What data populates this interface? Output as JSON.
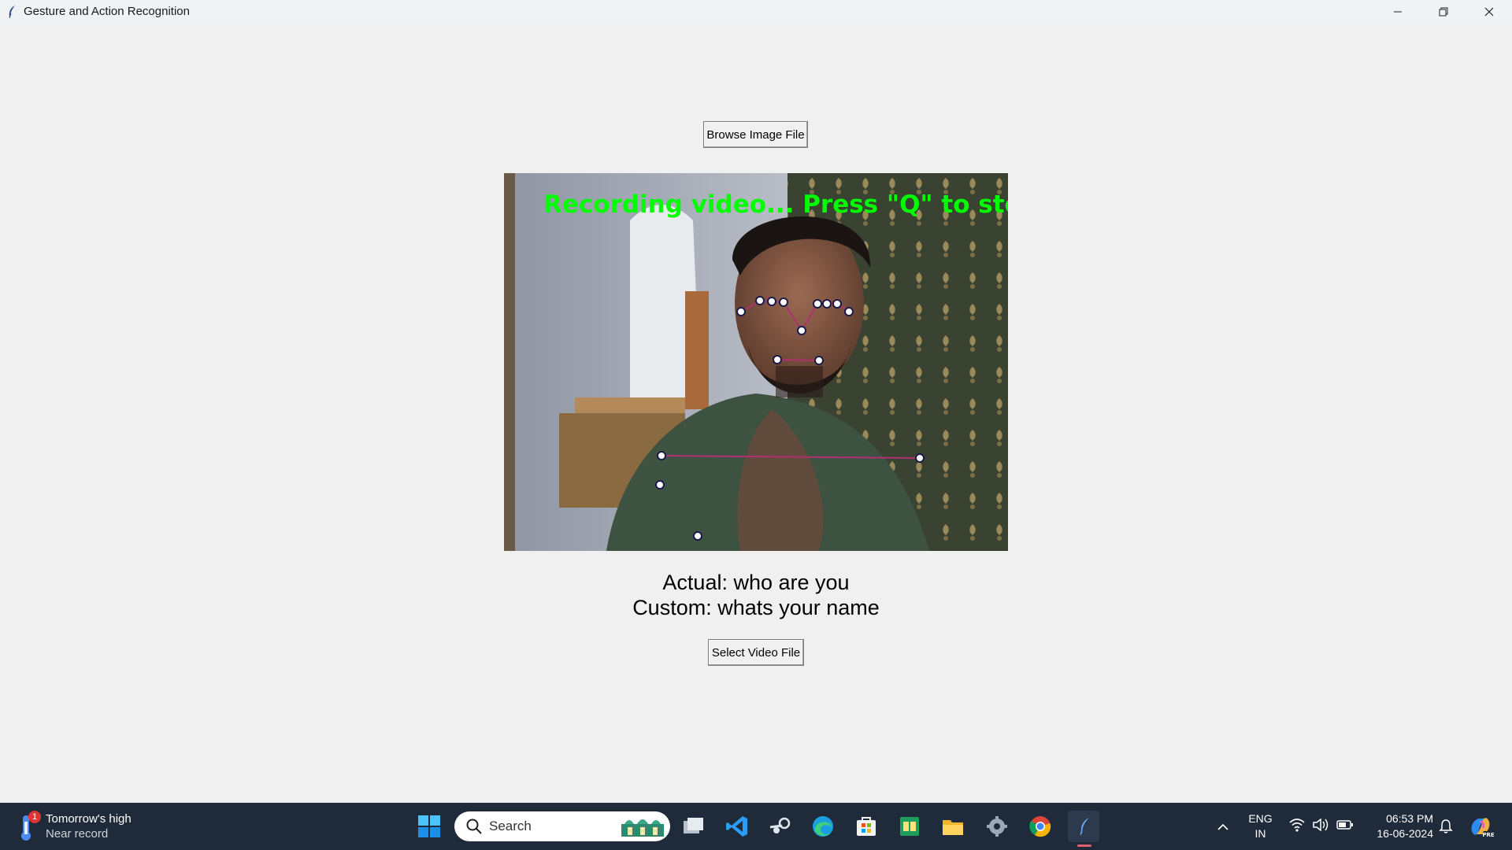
{
  "window": {
    "title": "Gesture and Action Recognition"
  },
  "buttons": {
    "browse_image": "Browse Image File",
    "select_video": "Select Video File"
  },
  "video": {
    "overlay_text": "Recording video... Press \"Q\" to stop!",
    "overlay_color": "#00ff00",
    "landmark_line_color": "#b03070"
  },
  "results": {
    "actual": "Actual: who are you",
    "custom": "Custom: whats your name"
  },
  "taskbar": {
    "weather_title": "Tomorrow's high",
    "weather_subtitle": "Near record",
    "weather_badge": "1",
    "search_placeholder": "Search",
    "language_top": "ENG",
    "language_bottom": "IN",
    "time": "06:53 PM",
    "date": "16-06-2024",
    "apps": [
      "start-icon",
      "task-view-icon",
      "vscode-icon",
      "steam-icon",
      "edge-icon",
      "store-icon",
      "sheets-icon",
      "file-explorer-icon",
      "settings-icon",
      "chrome-icon",
      "python-feather-icon"
    ]
  }
}
